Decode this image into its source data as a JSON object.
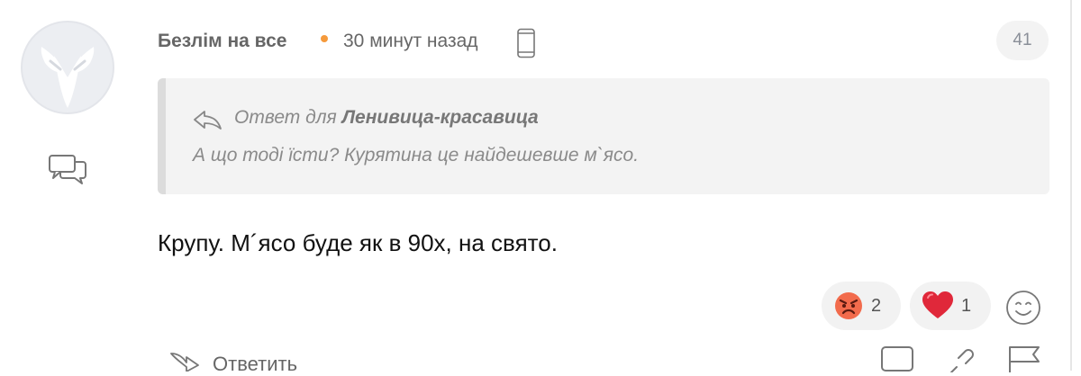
{
  "comment": {
    "author": "Безлім на все",
    "time": "30 минут назад",
    "count": "41",
    "quote": {
      "prefix": "Ответ для",
      "author": "Ленивица-красавица",
      "text": "А що тоді їсти? Курятина це найдешевше м`ясо."
    },
    "text": "Крупу. М´ясо буде як в 90х, на свято.",
    "reactions": [
      {
        "icon": "angry-face-emoji",
        "count": "2"
      },
      {
        "icon": "heart-emoji",
        "count": "1"
      }
    ],
    "actions": {
      "reply_label": "Ответить"
    }
  },
  "colors": {
    "online_dot": "#f59a3c",
    "badge_bg": "#f3f3f3",
    "quote_bg": "#f3f3f3",
    "reaction_bg": "#f2f2f2"
  }
}
